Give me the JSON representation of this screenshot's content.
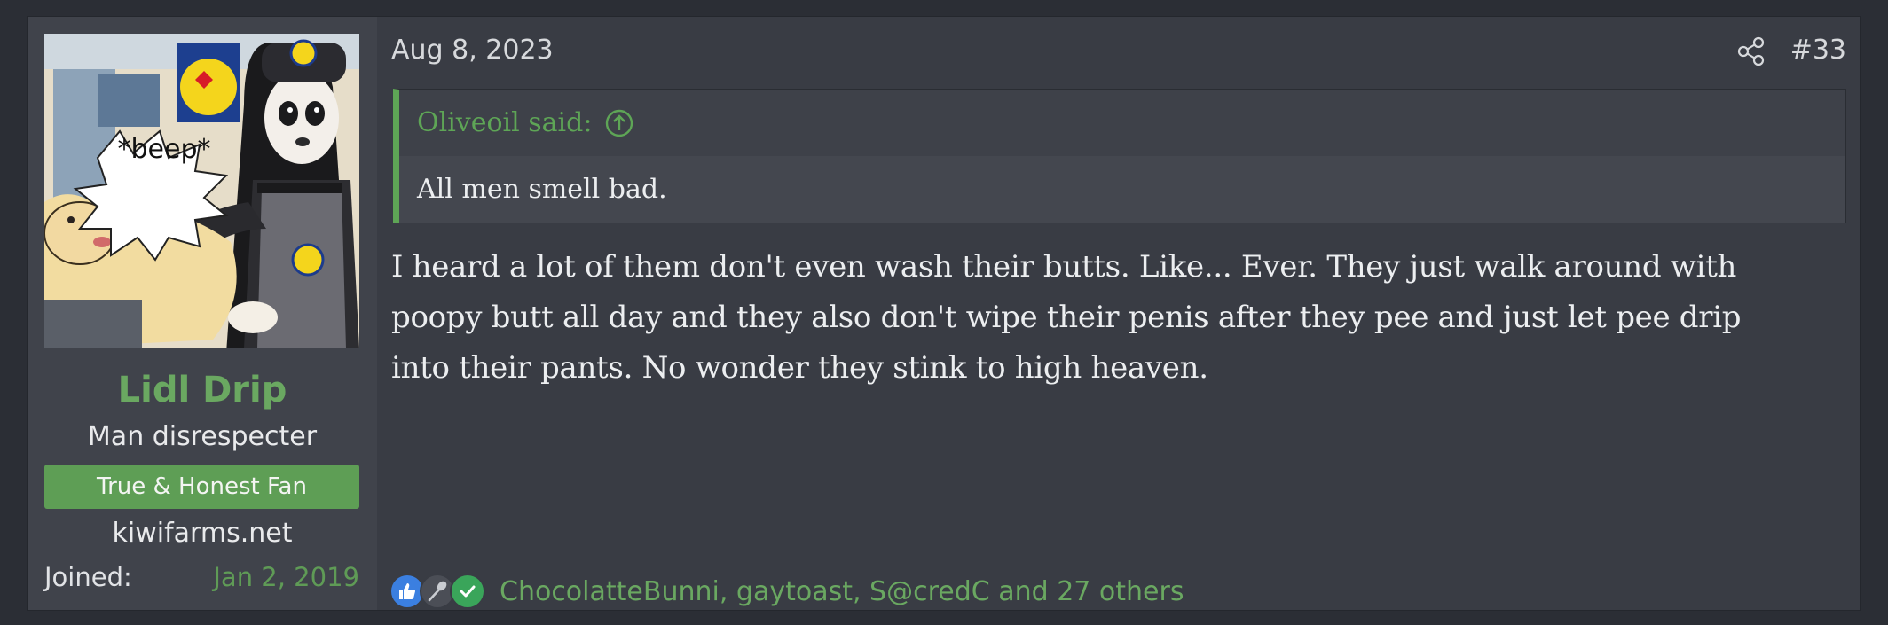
{
  "user": {
    "avatar_caption": "*beep*",
    "username": "Lidl Drip",
    "title": "Man disrespecter",
    "banner": "True & Honest Fan",
    "site": "kiwifarms.net",
    "joined_label": "Joined:",
    "joined_value": "Jan 2, 2019"
  },
  "post": {
    "date": "Aug 8, 2023",
    "number": "#33",
    "quote": {
      "author": "Oliveoil said:",
      "text": "All men smell bad."
    },
    "message": [
      "I heard a lot of them don't even wash their butts. Like... Ever. They just walk around with",
      "poopy butt all day and they also don't wipe their penis after they pee and just let pee drip",
      "into their pants. No wonder they stink to high heaven."
    ],
    "reactions": {
      "icons": [
        "thumbs-up-icon",
        "spoon-icon",
        "checkmark-icon"
      ],
      "names": "ChocolatteBunni, gaytoast, S@credC and 27 others"
    }
  },
  "colors": {
    "accent_green": "#6aa861",
    "banner_green": "#5e9e55",
    "post_bg": "#393c44",
    "user_bg": "#40434b"
  }
}
